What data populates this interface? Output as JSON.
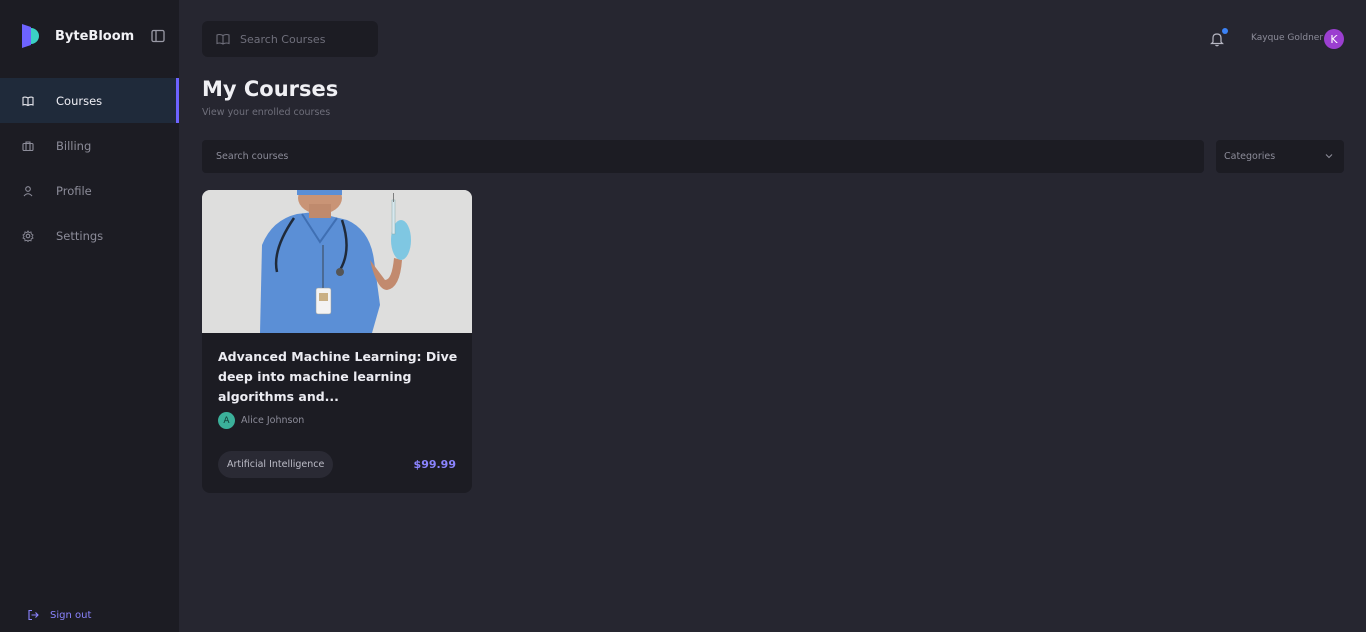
{
  "brand": {
    "name": "ByteBloom"
  },
  "sidebar": {
    "items": [
      {
        "label": "Courses",
        "icon": "book-icon",
        "active": true
      },
      {
        "label": "Billing",
        "icon": "briefcase-icon",
        "active": false
      },
      {
        "label": "Profile",
        "icon": "user-icon",
        "active": false
      },
      {
        "label": "Settings",
        "icon": "gear-icon",
        "active": false
      }
    ],
    "signout_label": "Sign out"
  },
  "header": {
    "search_placeholder": "Search Courses",
    "user_name": "Kayque Goldner",
    "user_initial": "K"
  },
  "page": {
    "title": "My Courses",
    "subtitle": "View your enrolled courses",
    "search_placeholder": "Search courses",
    "categories_label": "Categories"
  },
  "courses": [
    {
      "title": "Advanced Machine Learning: Dive deep into machine learning algorithms and...",
      "author": "Alice Johnson",
      "author_initial": "A",
      "category": "Artificial Intelligence",
      "price": "$99.99"
    }
  ],
  "colors": {
    "accent": "#6d63ff",
    "price": "#8b84ff",
    "sidebar_bg": "#1c1c23",
    "main_bg": "#262630",
    "notification_dot": "#3b82f6",
    "user_avatar": "#9b3fd0",
    "author_avatar": "#3bb09a"
  }
}
